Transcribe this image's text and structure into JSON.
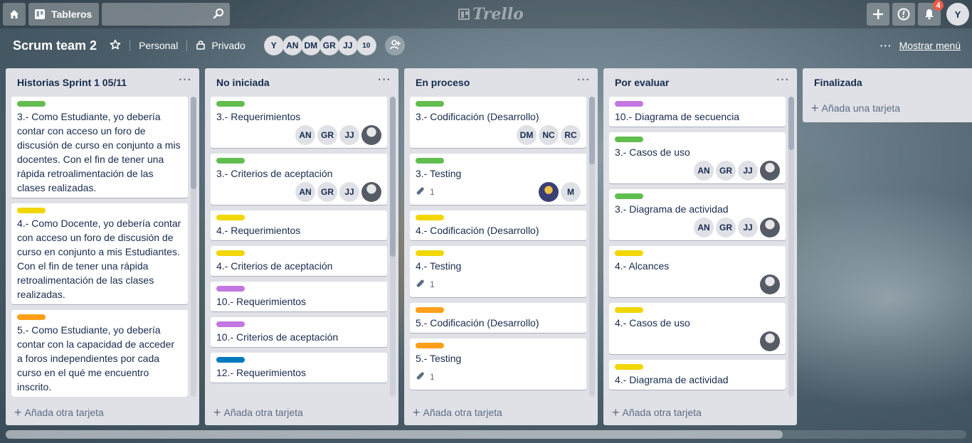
{
  "header": {
    "boards_label": "Tableros",
    "search_placeholder": "",
    "logo_text": "Trello",
    "notifications_count": "4",
    "user_initial": "Y"
  },
  "board": {
    "title": "Scrum team 2",
    "team": "Personal",
    "visibility": "Privado",
    "members": [
      "Y",
      "AN",
      "DM",
      "GR",
      "JJ"
    ],
    "members_more": "10",
    "show_menu": "Mostrar menú"
  },
  "add_another": "Añada otra tarjeta",
  "add_first": "Añada una tarjeta",
  "label_colors": {
    "green": "#61bd4f",
    "yellow": "#f2d600",
    "orange": "#ff9f1a",
    "purple": "#c377e0",
    "blue": "#0079bf"
  },
  "lists": [
    {
      "title": "Historias Sprint 1 05/11",
      "cards": [
        {
          "label": "green",
          "title": "3.- Como Estudiante, yo debería contar con acceso un foro de discusión de curso en conjunto a mis docentes. Con el fin de tener una rápida retroalimentación de las clases realizadas."
        },
        {
          "label": "yellow",
          "title": "4.- Como Docente, yo debería contar con acceso un foro de discusión de curso en conjunto a mis Estudiantes. Con el fin de tener una rápida retroalimentación de las clases realizadas."
        },
        {
          "label": "orange",
          "title": "5.- Como Estudiante, yo debería contar con la capacidad de acceder a foros independientes por cada curso en el qué me encuentro inscrito."
        }
      ]
    },
    {
      "title": "No iniciada",
      "cards": [
        {
          "label": "green",
          "title": "3.- Requerimientos",
          "members": [
            "AN",
            "GR",
            "JJ",
            "photo"
          ]
        },
        {
          "label": "green",
          "title": "3.- Criterios de aceptación",
          "members": [
            "AN",
            "GR",
            "JJ",
            "photo"
          ]
        },
        {
          "label": "yellow",
          "title": "4.- Requerimientos"
        },
        {
          "label": "yellow",
          "title": "4.- Criterios de aceptación"
        },
        {
          "label": "purple",
          "title": "10.- Requerimientos"
        },
        {
          "label": "purple",
          "title": "10.- Criterios de aceptación"
        },
        {
          "label": "blue",
          "title": "12.- Requerimientos"
        }
      ]
    },
    {
      "title": "En proceso",
      "cards": [
        {
          "label": "green",
          "title": "3.- Codificación (Desarrollo)",
          "members": [
            "DM",
            "NC",
            "RC"
          ]
        },
        {
          "label": "green",
          "title": "3.- Testing",
          "attachments": "1",
          "members": [
            "photo2",
            "M"
          ]
        },
        {
          "label": "yellow",
          "title": "4.- Codificación (Desarrollo)"
        },
        {
          "label": "yellow",
          "title": "4.- Testing",
          "attachments": "1"
        },
        {
          "label": "orange",
          "title": "5.- Codificación (Desarrollo)"
        },
        {
          "label": "orange",
          "title": "5.- Testing",
          "attachments": "1"
        }
      ]
    },
    {
      "title": "Por evaluar",
      "cards": [
        {
          "label": "purple",
          "title": "10.- Diagrama de secuencia"
        },
        {
          "label": "green",
          "title": "3.- Casos de uso",
          "members": [
            "AN",
            "GR",
            "JJ",
            "photo"
          ]
        },
        {
          "label": "green",
          "title": "3.- Diagrama de actividad",
          "members": [
            "AN",
            "GR",
            "JJ",
            "photo"
          ]
        },
        {
          "label": "yellow",
          "title": "4.- Alcances",
          "members": [
            "photo"
          ]
        },
        {
          "label": "yellow",
          "title": "4.- Casos de uso",
          "members": [
            "photo"
          ]
        },
        {
          "label": "yellow",
          "title": "4.- Diagrama de actividad"
        }
      ]
    },
    {
      "title": "Finalizada",
      "cards": []
    }
  ]
}
